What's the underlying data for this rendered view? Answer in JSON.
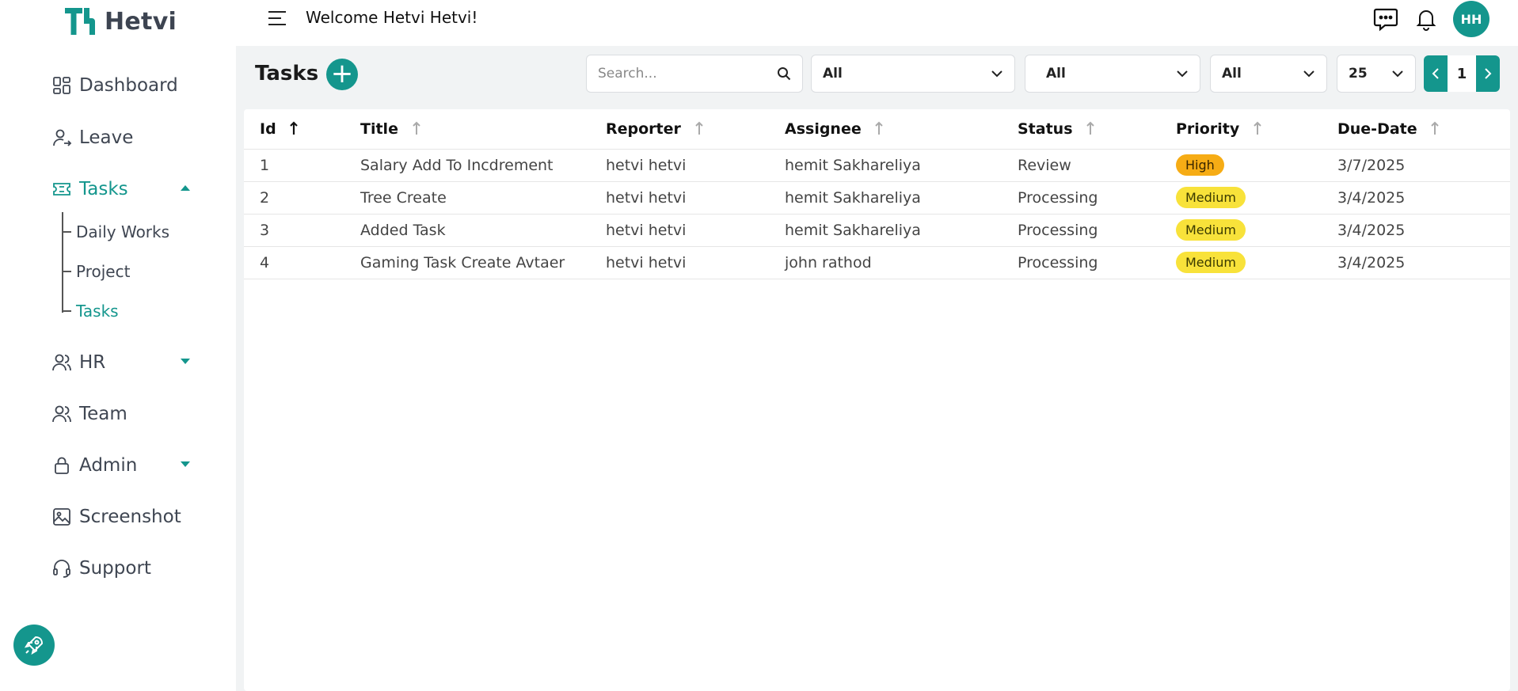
{
  "brand": {
    "name": "Hetvi",
    "accent": "#14968d"
  },
  "header": {
    "welcome": "Welcome Hetvi Hetvi!",
    "avatar_initials": "HH"
  },
  "sidebar": {
    "items": [
      {
        "label": "Dashboard",
        "icon": "dashboard-icon"
      },
      {
        "label": "Leave",
        "icon": "user-arrow-icon"
      },
      {
        "label": "Tasks",
        "icon": "ticket-icon",
        "expanded": true
      },
      {
        "label": "HR",
        "icon": "users-icon"
      },
      {
        "label": "Team",
        "icon": "users-icon"
      },
      {
        "label": "Admin",
        "icon": "lock-icon"
      },
      {
        "label": "Screenshot",
        "icon": "image-icon"
      },
      {
        "label": "Support",
        "icon": "headset-icon"
      }
    ],
    "tasks_sub": [
      "Daily Works",
      "Project",
      "Tasks"
    ]
  },
  "toolbar": {
    "title": "Tasks",
    "search_placeholder": "Search...",
    "filters": [
      "All",
      "All",
      "All"
    ],
    "page_size": "25",
    "page": "1"
  },
  "table": {
    "columns": [
      "Id",
      "Title",
      "Reporter",
      "Assignee",
      "Status",
      "Priority",
      "Due-Date"
    ],
    "rows": [
      {
        "id": "1",
        "title": "Salary Add To Incdrement",
        "reporter": "hetvi hetvi",
        "assignee": "hemit Sakhareliya",
        "status": "Review",
        "priority": "High",
        "due": "3/7/2025"
      },
      {
        "id": "2",
        "title": "Tree Create",
        "reporter": "hetvi hetvi",
        "assignee": "hemit Sakhareliya",
        "status": "Processing",
        "priority": "Medium",
        "due": "3/4/2025"
      },
      {
        "id": "3",
        "title": "Added Task",
        "reporter": "hetvi hetvi",
        "assignee": "hemit Sakhareliya",
        "status": "Processing",
        "priority": "Medium",
        "due": "3/4/2025"
      },
      {
        "id": "4",
        "title": "Gaming Task Create Avtaer",
        "reporter": "hetvi hetvi",
        "assignee": "john rathod",
        "status": "Processing",
        "priority": "Medium",
        "due": "3/4/2025"
      }
    ]
  }
}
